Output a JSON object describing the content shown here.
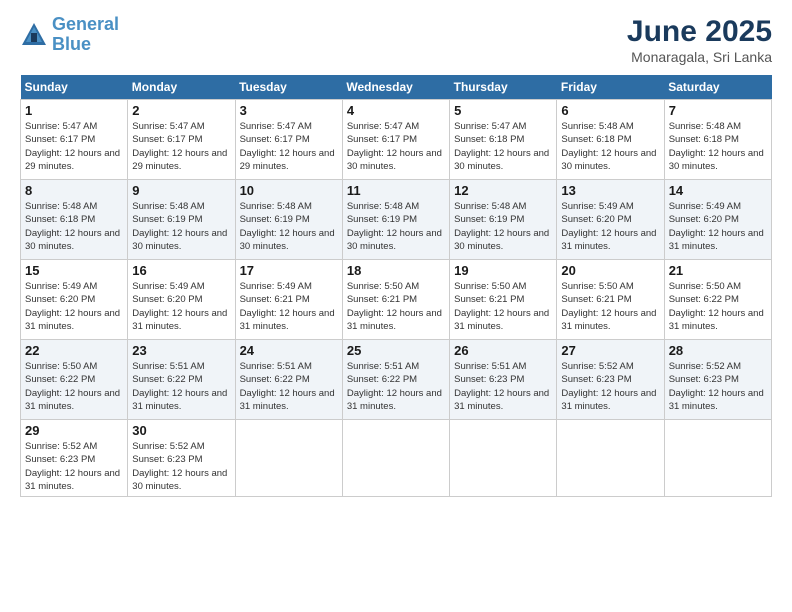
{
  "logo": {
    "line1": "General",
    "line2": "Blue"
  },
  "title": "June 2025",
  "location": "Monaragala, Sri Lanka",
  "weekdays": [
    "Sunday",
    "Monday",
    "Tuesday",
    "Wednesday",
    "Thursday",
    "Friday",
    "Saturday"
  ],
  "weeks": [
    [
      {
        "day": "1",
        "sunrise": "5:47 AM",
        "sunset": "6:17 PM",
        "daylight": "12 hours and 29 minutes."
      },
      {
        "day": "2",
        "sunrise": "5:47 AM",
        "sunset": "6:17 PM",
        "daylight": "12 hours and 29 minutes."
      },
      {
        "day": "3",
        "sunrise": "5:47 AM",
        "sunset": "6:17 PM",
        "daylight": "12 hours and 29 minutes."
      },
      {
        "day": "4",
        "sunrise": "5:47 AM",
        "sunset": "6:17 PM",
        "daylight": "12 hours and 30 minutes."
      },
      {
        "day": "5",
        "sunrise": "5:47 AM",
        "sunset": "6:18 PM",
        "daylight": "12 hours and 30 minutes."
      },
      {
        "day": "6",
        "sunrise": "5:48 AM",
        "sunset": "6:18 PM",
        "daylight": "12 hours and 30 minutes."
      },
      {
        "day": "7",
        "sunrise": "5:48 AM",
        "sunset": "6:18 PM",
        "daylight": "12 hours and 30 minutes."
      }
    ],
    [
      {
        "day": "8",
        "sunrise": "5:48 AM",
        "sunset": "6:18 PM",
        "daylight": "12 hours and 30 minutes."
      },
      {
        "day": "9",
        "sunrise": "5:48 AM",
        "sunset": "6:19 PM",
        "daylight": "12 hours and 30 minutes."
      },
      {
        "day": "10",
        "sunrise": "5:48 AM",
        "sunset": "6:19 PM",
        "daylight": "12 hours and 30 minutes."
      },
      {
        "day": "11",
        "sunrise": "5:48 AM",
        "sunset": "6:19 PM",
        "daylight": "12 hours and 30 minutes."
      },
      {
        "day": "12",
        "sunrise": "5:48 AM",
        "sunset": "6:19 PM",
        "daylight": "12 hours and 30 minutes."
      },
      {
        "day": "13",
        "sunrise": "5:49 AM",
        "sunset": "6:20 PM",
        "daylight": "12 hours and 31 minutes."
      },
      {
        "day": "14",
        "sunrise": "5:49 AM",
        "sunset": "6:20 PM",
        "daylight": "12 hours and 31 minutes."
      }
    ],
    [
      {
        "day": "15",
        "sunrise": "5:49 AM",
        "sunset": "6:20 PM",
        "daylight": "12 hours and 31 minutes."
      },
      {
        "day": "16",
        "sunrise": "5:49 AM",
        "sunset": "6:20 PM",
        "daylight": "12 hours and 31 minutes."
      },
      {
        "day": "17",
        "sunrise": "5:49 AM",
        "sunset": "6:21 PM",
        "daylight": "12 hours and 31 minutes."
      },
      {
        "day": "18",
        "sunrise": "5:50 AM",
        "sunset": "6:21 PM",
        "daylight": "12 hours and 31 minutes."
      },
      {
        "day": "19",
        "sunrise": "5:50 AM",
        "sunset": "6:21 PM",
        "daylight": "12 hours and 31 minutes."
      },
      {
        "day": "20",
        "sunrise": "5:50 AM",
        "sunset": "6:21 PM",
        "daylight": "12 hours and 31 minutes."
      },
      {
        "day": "21",
        "sunrise": "5:50 AM",
        "sunset": "6:22 PM",
        "daylight": "12 hours and 31 minutes."
      }
    ],
    [
      {
        "day": "22",
        "sunrise": "5:50 AM",
        "sunset": "6:22 PM",
        "daylight": "12 hours and 31 minutes."
      },
      {
        "day": "23",
        "sunrise": "5:51 AM",
        "sunset": "6:22 PM",
        "daylight": "12 hours and 31 minutes."
      },
      {
        "day": "24",
        "sunrise": "5:51 AM",
        "sunset": "6:22 PM",
        "daylight": "12 hours and 31 minutes."
      },
      {
        "day": "25",
        "sunrise": "5:51 AM",
        "sunset": "6:22 PM",
        "daylight": "12 hours and 31 minutes."
      },
      {
        "day": "26",
        "sunrise": "5:51 AM",
        "sunset": "6:23 PM",
        "daylight": "12 hours and 31 minutes."
      },
      {
        "day": "27",
        "sunrise": "5:52 AM",
        "sunset": "6:23 PM",
        "daylight": "12 hours and 31 minutes."
      },
      {
        "day": "28",
        "sunrise": "5:52 AM",
        "sunset": "6:23 PM",
        "daylight": "12 hours and 31 minutes."
      }
    ],
    [
      {
        "day": "29",
        "sunrise": "5:52 AM",
        "sunset": "6:23 PM",
        "daylight": "12 hours and 31 minutes."
      },
      {
        "day": "30",
        "sunrise": "5:52 AM",
        "sunset": "6:23 PM",
        "daylight": "12 hours and 30 minutes."
      },
      null,
      null,
      null,
      null,
      null
    ]
  ]
}
